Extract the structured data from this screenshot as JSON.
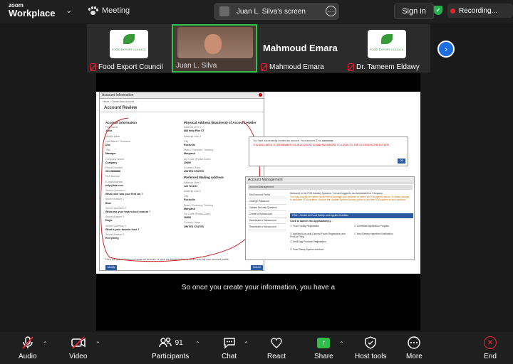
{
  "app": {
    "logo_top": "zoom",
    "logo_bottom": "Workplace",
    "meeting_label": "Meeting"
  },
  "screen_share": {
    "owner_label": "Juan L. Silva's screen"
  },
  "header": {
    "signin_label": "Sign in",
    "recording_label": "Recording..."
  },
  "participants": [
    {
      "name": "Food Export Council",
      "muted": true
    },
    {
      "name": "Juan L. Silva",
      "muted": false,
      "active": true
    },
    {
      "name": "Mahmoud Emara",
      "muted": true
    },
    {
      "name": "Dr. Tameem Eldawy",
      "muted": true
    }
  ],
  "logo_text": "FOOD EXPORT COUNCIL",
  "active_speaker": "Mahmoud Emara",
  "shared_content": {
    "account_info_window": "Account Information",
    "breadcrumb": "Home  ›  Create New Account",
    "review_title": "Account Review",
    "left_heading": "Account Information",
    "left_fields": [
      {
        "k": "First Name",
        "v": "Jenia"
      },
      {
        "k": "Middle Initial",
        "v": ""
      },
      {
        "k": "Last Name / Surname",
        "v": "Doe"
      },
      {
        "k": "Title",
        "v": "Manager"
      },
      {
        "k": "Company Name",
        "v": "Company"
      },
      {
        "k": "Phone Number",
        "v": "301 8888888"
      },
      {
        "k": "FAX Number",
        "v": ""
      },
      {
        "k": "E-mail Address",
        "v": "help@fda.com"
      },
      {
        "k": "Secret Question 1",
        "v": "What color was your first car ?"
      },
      {
        "k": "Secret Answer 1",
        "v": "Blue"
      },
      {
        "k": "Secret Question 2",
        "v": "What was your high school mascot ?"
      },
      {
        "k": "Secret Answer 2",
        "v": "Eagle"
      },
      {
        "k": "Secret Question 3",
        "v": "What is your favorite food ?"
      },
      {
        "k": "Secret Answer 3",
        "v": "Everything"
      }
    ],
    "right_heading_1": "Physical Address (Business) of Account Holder",
    "right_fields_1": [
      {
        "k": "Address Line 1",
        "v": "888 Help Pike ST"
      },
      {
        "k": "Address Line 2",
        "v": ""
      },
      {
        "k": "City",
        "v": "Rockville"
      },
      {
        "k": "State / Province / Territory",
        "v": "Maryland"
      },
      {
        "k": "Zip Code (Postal Code)",
        "v": "20850"
      },
      {
        "k": "Country / Area",
        "v": "UNITED STATES"
      }
    ],
    "right_heading_2": "Preferred Mailing Address",
    "right_fields_2": [
      {
        "k": "Address Line 1",
        "v": "123 Test Dr"
      },
      {
        "k": "Address Line 2",
        "v": ""
      },
      {
        "k": "City",
        "v": "Rockville"
      },
      {
        "k": "State / Province / Territory",
        "v": "Maryland"
      },
      {
        "k": "Zip Code (Postal Code)",
        "v": "20850"
      },
      {
        "k": "Country / Area",
        "v": "UNITED STATES"
      }
    ],
    "submit_note": "Click the Submit button to create an account, or click the Modify button to return and edit your account profile.",
    "modify_label": "Modify",
    "submit_label": "Submit",
    "popup_text": "You have successfully created an account.\nYour account ID is: ",
    "popup_id": "xxxxxxxx",
    "popup_warning": "YOU WILL NEED TO REMEMBER YOUR ACCOUNT ID AND PASSWORD TO LOGIN TO THE SYSTEM IN THE FUTURE",
    "popup_ok": "OK",
    "acc_mgmt_window": "Account Management",
    "acc_mgmt_tab": "Account Management",
    "left_nav": [
      "Edit Account Profile",
      "Change Password",
      "Update Security Question",
      "Create a Subaccount",
      "Deactivate a Subaccount",
      "Reactivate a Subaccount"
    ],
    "welcome_line": "Welcome to the FDA Industry Systems. You are logged in as user###### for Company.",
    "welcome_instr": "You may choose an option on the left to manage your account or select an FDA system below. To obtain access to available FDA systems, choose the Update System Access option to add the FDA system to your account.",
    "fsm_bar": "FSM - Center for Food Safety and Applied Nutrition",
    "apps_label": "Click to launch the Application(s):",
    "apps": [
      "Food Facility Registration",
      "Certificate Application Program",
      "Acidified/Low-acid Canned Foods Registration and Product Filing",
      "New Dietary Ingredient Notification",
      "Shell Egg Producer Registration",
      "Food Safety System Interface"
    ]
  },
  "caption": "So once you create your information, you have a",
  "toolbar": {
    "audio": "Audio",
    "video": "Video",
    "participants": "Participants",
    "participant_count": "91",
    "chat": "Chat",
    "react": "React",
    "share": "Share",
    "host_tools": "Host tools",
    "more": "More",
    "end": "End"
  },
  "colors": {
    "active_border": "#2fbf4a",
    "recording_dot": "#e02828",
    "end_red": "#e22233",
    "share_green": "#2fbf4a",
    "nav_blue": "#1d6ce0"
  }
}
